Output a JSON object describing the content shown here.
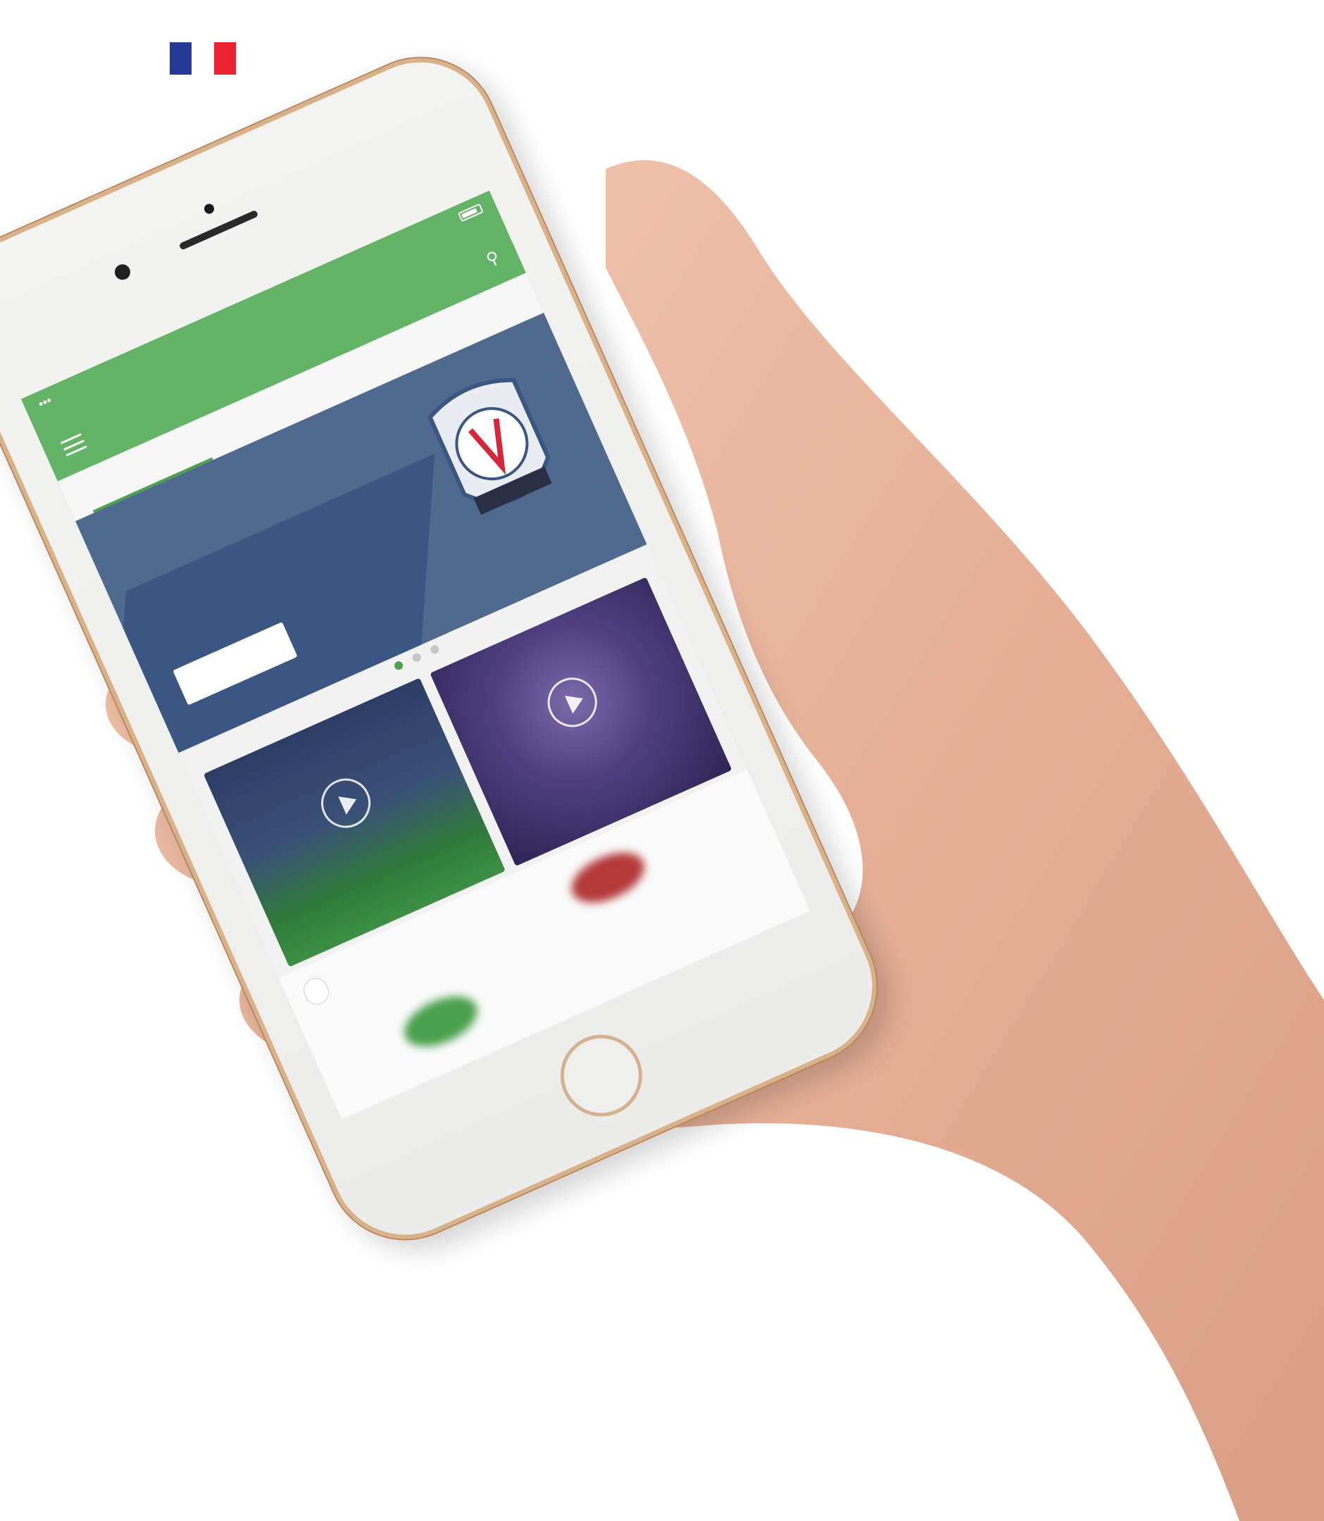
{
  "flag": {
    "colors": [
      "#243a96",
      "#ffffff",
      "#e8222f"
    ],
    "icon": "france-flag-icon"
  },
  "app": {
    "brand_color": "#64b467",
    "status_time": "",
    "title": "",
    "tabs": [
      {
        "label": "",
        "active": true
      },
      {
        "label": "",
        "active": false
      },
      {
        "label": "",
        "active": false
      }
    ]
  },
  "banner": {
    "text": "",
    "button_label": "",
    "background": "#506a8f"
  },
  "carousel": {
    "dot_count": 3,
    "active_index": 0
  },
  "cards": [
    {
      "kind": "stadium",
      "icon": "play-icon"
    },
    {
      "kind": "arena",
      "icon": "play-icon"
    }
  ],
  "shop": {
    "section_label": ""
  },
  "colors": {
    "skin": "#e8b7a0",
    "phone_frame": "#d9b28a",
    "screen_bg": "#f2f2f2"
  }
}
